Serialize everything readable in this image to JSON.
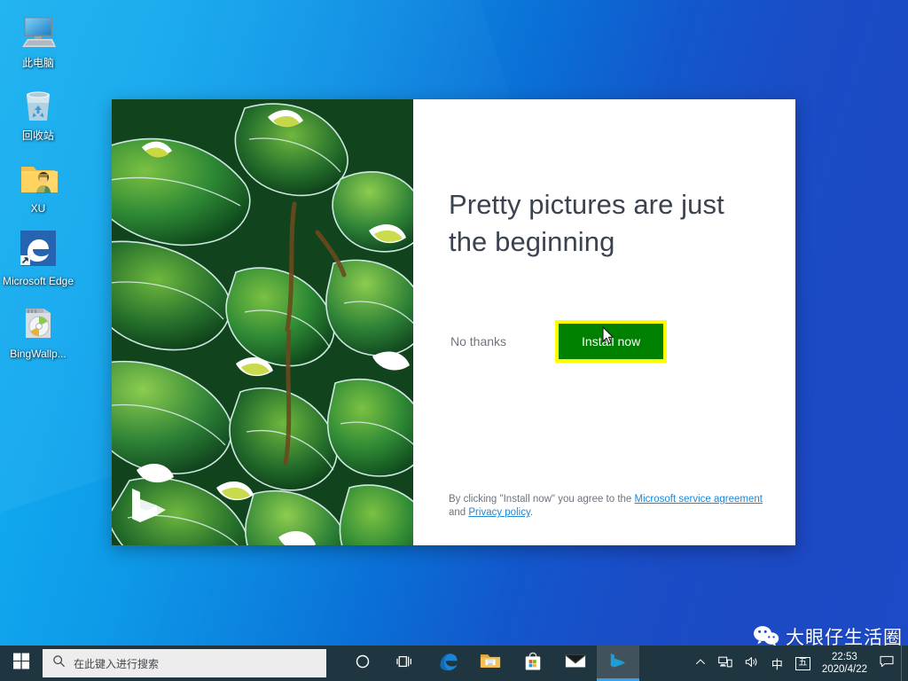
{
  "desktop": {
    "wallpaper_colors": {
      "left": "#12AEF0",
      "right": "#1D4AC6"
    },
    "icons": [
      {
        "name": "this-pc",
        "label": "此电脑",
        "icon": "computer-icon"
      },
      {
        "name": "recycle-bin",
        "label": "回收站",
        "icon": "recycle-bin-icon"
      },
      {
        "name": "user-folder",
        "label": "XU",
        "icon": "user-folder-icon"
      },
      {
        "name": "microsoft-edge",
        "label": "Microsoft Edge",
        "icon": "edge-icon"
      },
      {
        "name": "bing-wallpaper",
        "label": "BingWallp...",
        "icon": "cd-package-icon"
      }
    ]
  },
  "dialog": {
    "app": "Bing Wallpaper",
    "hero_image_alt": "agave-succulent-photo",
    "bing_logo": "bing-b-logo",
    "headline": "Pretty pictures are just the beginning",
    "no_thanks_label": "No thanks",
    "install_label": "Install now",
    "install_button_color": "#008000",
    "highlight_color": "#FFFF00",
    "legal": {
      "prefix": "By clicking \"Install now\" you agree to the ",
      "link1": "Microsoft service agreement",
      "middle": " and ",
      "link2": "Privacy policy",
      "suffix": ".",
      "link_color": "#1F87D6"
    }
  },
  "taskbar": {
    "background": "#1F3641",
    "start_label": "start-button",
    "search": {
      "placeholder": "在此键入进行搜索",
      "icon": "search-icon"
    },
    "apps": [
      {
        "name": "cortana",
        "icon": "cortana-circle-icon",
        "active": false
      },
      {
        "name": "task-view",
        "icon": "task-view-icon",
        "active": false
      },
      {
        "name": "microsoft-edge",
        "icon": "edge-icon",
        "active": false
      },
      {
        "name": "file-explorer",
        "icon": "folder-icon",
        "active": false
      },
      {
        "name": "microsoft-store",
        "icon": "store-bag-icon",
        "active": false
      },
      {
        "name": "mail",
        "icon": "mail-envelope-icon",
        "active": false
      },
      {
        "name": "bing-wallpaper",
        "icon": "bing-b-icon",
        "active": true
      }
    ],
    "tray": [
      {
        "name": "show-hidden-icons",
        "icon": "chevron-up-icon",
        "label": ""
      },
      {
        "name": "network",
        "icon": "network-icon",
        "label": ""
      },
      {
        "name": "volume",
        "icon": "speaker-icon",
        "label": ""
      },
      {
        "name": "ime-mode",
        "icon": "ime-icon",
        "label": "中"
      },
      {
        "name": "ime-wubi",
        "icon": "ime-wubi-icon",
        "label": "五"
      }
    ],
    "clock": {
      "time": "22:53",
      "date": "2020/4/22"
    },
    "notifications_icon": "action-center-icon"
  },
  "watermark": {
    "icon": "wechat-icon",
    "text": "大眼仔生活圈"
  }
}
